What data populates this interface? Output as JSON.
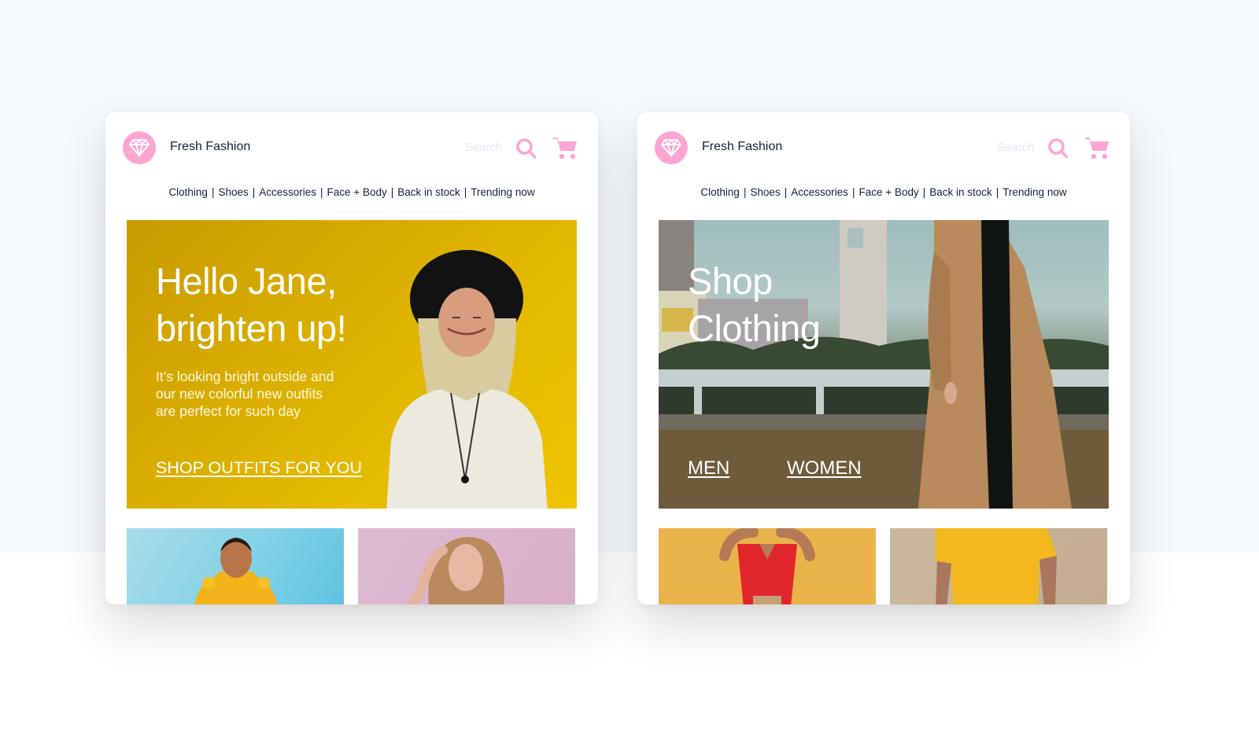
{
  "colors": {
    "accent_pink": "#fca5d1",
    "text_dark": "#14213a",
    "search_placeholder": "#e3e7ee",
    "page_bg_top": "#f4f9fd",
    "hero_yellow": "#e0b400"
  },
  "cards": [
    {
      "id": "left",
      "header": {
        "logo_icon": "diamond-icon",
        "brand": "Fresh Fashion",
        "search_placeholder": "Search",
        "search_icon": "search-icon",
        "cart_icon": "shopping-cart-icon"
      },
      "nav": {
        "items": [
          "Clothing",
          "Shoes",
          "Accessories",
          "Face + Body",
          "Back in stock",
          "Trending now"
        ],
        "separator": "|"
      },
      "hero": {
        "title_line1": "Hello Jane,",
        "title_line2": "brighten up!",
        "subtitle_line1": "It’s looking bright outside and",
        "subtitle_line2": "our new colorful new outfits",
        "subtitle_line3": "are perfect for such day",
        "cta": "SHOP OUTFITS FOR YOU",
        "image": "Smiling woman in black hat and white sweater against yellow wall"
      },
      "tiles": [
        {
          "image": "Woman in yellow hoodie against blue sky"
        },
        {
          "image": "Woman with long wavy hair against pink wall"
        }
      ]
    },
    {
      "id": "right",
      "header": {
        "logo_icon": "diamond-icon",
        "brand": "Fresh Fashion",
        "search_placeholder": "Search",
        "search_icon": "search-icon",
        "cart_icon": "shopping-cart-icon"
      },
      "nav": {
        "items": [
          "Clothing",
          "Shoes",
          "Accessories",
          "Face + Body",
          "Back in stock",
          "Trending now"
        ],
        "separator": "|"
      },
      "hero": {
        "title_line1": "Shop",
        "title_line2": "Clothing",
        "cta_men": "MEN",
        "cta_women": "WOMEN",
        "image": "Person in camel coat standing in front of city buildings"
      },
      "tiles": [
        {
          "image": "Woman in red patterned dress against orange wall"
        },
        {
          "image": "Man in yellow t-shirt against beige wall"
        }
      ]
    }
  ]
}
